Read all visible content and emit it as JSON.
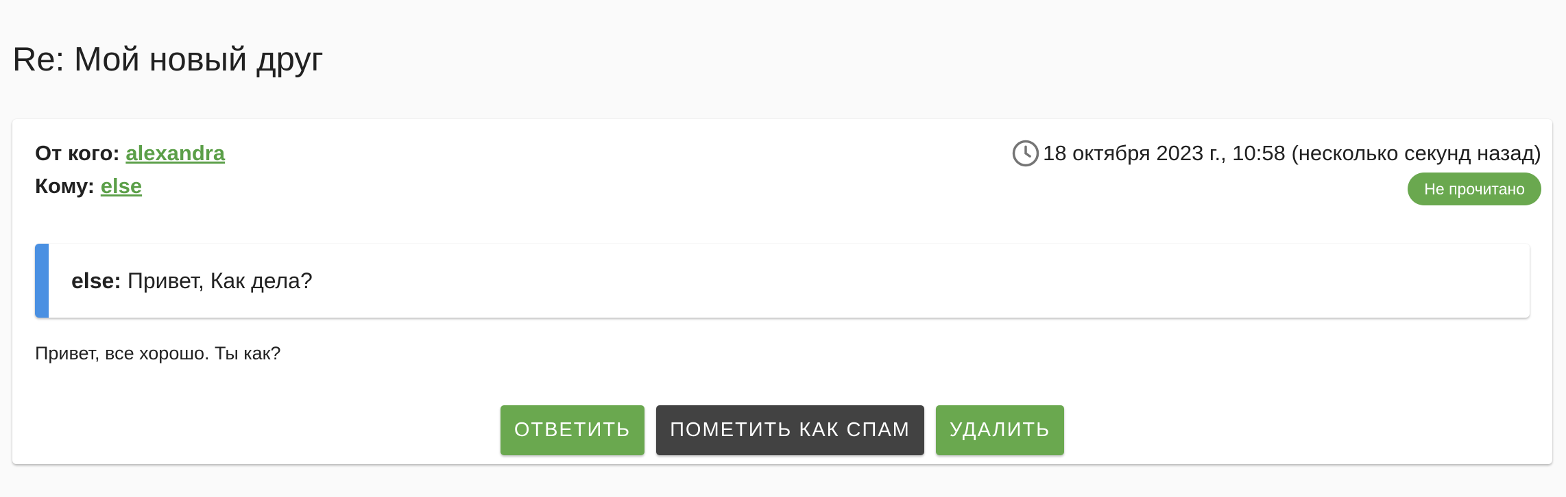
{
  "page": {
    "title": "Re: Мой новый друг"
  },
  "message": {
    "from_label": "От кого:",
    "from_user": "alexandra",
    "to_label": "Кому:",
    "to_user": "else",
    "date": "18 октября 2023 г., 10:58 (несколько секунд назад)",
    "status": "Не прочитано",
    "quote_author": "else:",
    "quote_text": "Привет, Как дела?",
    "body": "Привет, все хорошо. Ты как?"
  },
  "actions": {
    "reply": "Ответить",
    "spam": "Пометить как спам",
    "delete": "Удалить"
  },
  "icons": {
    "date": "clock-icon"
  },
  "colors": {
    "accent_green": "#6aa84f",
    "link_green": "#5b9f48",
    "quote_bar_blue": "#4a90e2",
    "dark_button": "#424242"
  }
}
